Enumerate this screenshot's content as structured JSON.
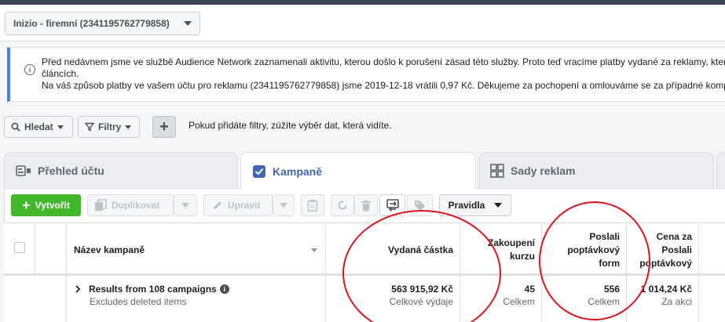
{
  "account": {
    "selector_label": "Inizio - firemní (2341195762779858)"
  },
  "notice": {
    "line1": "Před nedávnem jsme ve službě Audience Network zaznamenali aktivitu, kterou došlo k porušení zásad této služby. Proto teď vracíme platby vydané za reklamy, kter",
    "line2": "článcích.",
    "line3": "Na váš způsob platby ve vašem účtu pro reklamu (2341195762779858) jsme 2019-12-18 vrátili 0,97 Kč. Děkujeme za pochopení a omlouváme se za případné komp"
  },
  "filters": {
    "search_label": "Hledat",
    "filters_label": "Filtry",
    "plus_label": "+",
    "hint": "Pokud přidáte filtry, zúžíte výběr dat, která vidíte."
  },
  "tabs": [
    {
      "label": "Přehled účtu",
      "icon": "account-overview-icon",
      "active": false
    },
    {
      "label": "Kampaně",
      "icon": "campaigns-checkbox-icon",
      "active": true
    },
    {
      "label": "Sady reklam",
      "icon": "ad-sets-grid-icon",
      "active": false
    }
  ],
  "toolbar": {
    "create_label": "Vytvořit",
    "duplicate_label": "Duplikovat",
    "edit_label": "Upravit",
    "rules_label": "Pravidla"
  },
  "table": {
    "columns": {
      "name": "Název kampaně",
      "spend": "Vydaná částka",
      "purchases_line1": "Zakoupení",
      "purchases_line2": "kurzu",
      "leads_line1": "Poslali",
      "leads_line2": "poptávkový",
      "leads_line3": "form",
      "cost_line1": "Cena za",
      "cost_line2": "Poslali",
      "cost_line3": "poptávkový"
    },
    "summary_row": {
      "title": "Results from 108 campaigns",
      "subtitle": "Excludes deleted items",
      "spend": "563 915,92 Kč",
      "spend_sub": "Celkové výdaje",
      "purchases": "45",
      "purchases_sub": "Celkem",
      "leads": "556",
      "leads_sub": "Celkem",
      "cost": "1 014,24 Kč",
      "cost_sub": "Za akci"
    }
  },
  "colors": {
    "accent": "#4267b2",
    "create_green": "#42b72a",
    "annotation_red": "#e0151b",
    "notice_border": "#4080ff"
  }
}
